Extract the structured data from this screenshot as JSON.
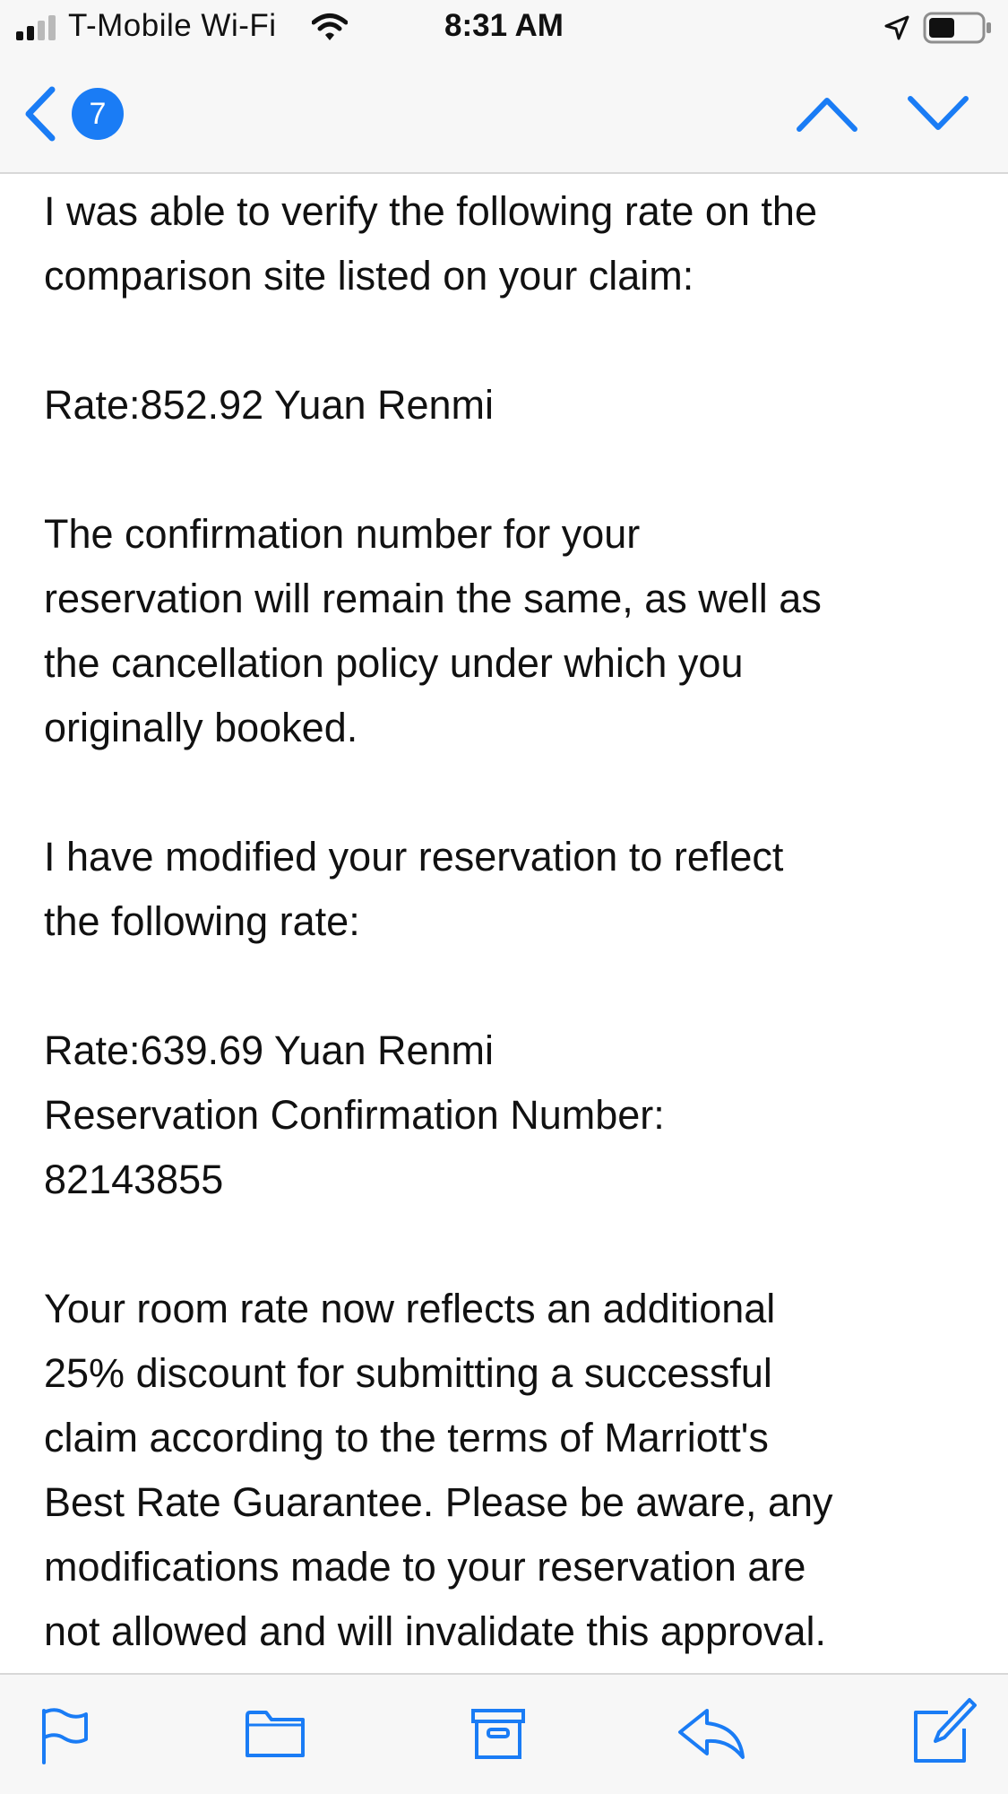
{
  "status_bar": {
    "carrier": "T-Mobile Wi-Fi",
    "time": "8:31 AM",
    "icons": [
      "signal-icon",
      "wifi-icon",
      "location-arrow-icon",
      "battery-icon"
    ]
  },
  "nav": {
    "unread_count": "7",
    "icons": [
      "back-chevron-icon",
      "up-chevron-icon",
      "down-chevron-icon"
    ]
  },
  "message": {
    "paragraphs": [
      "I was able to verify the following rate on the\ncomparison site listed on your claim:",
      "Rate:852.92 Yuan Renmi",
      "The confirmation number for your\nreservation will remain the same, as well as\nthe cancellation policy under which you\noriginally booked.",
      "I have modified your reservation to reflect\nthe following rate:",
      "Rate:639.69 Yuan Renmi\nReservation Confirmation Number:\n82143855",
      "Your room rate now reflects an additional\n25% discount for submitting a successful\nclaim according to the terms of Marriott's\nBest Rate Guarantee. Please be aware, any\nmodifications made to your reservation are\nnot allowed and will invalidate this approval."
    ]
  },
  "toolbar": {
    "icons": [
      "flag-icon",
      "folder-icon",
      "archive-icon",
      "reply-icon",
      "compose-icon"
    ]
  },
  "colors": {
    "accent": "#1a7cf5",
    "bar_background": "#f7f7f7",
    "text": "#111111"
  }
}
